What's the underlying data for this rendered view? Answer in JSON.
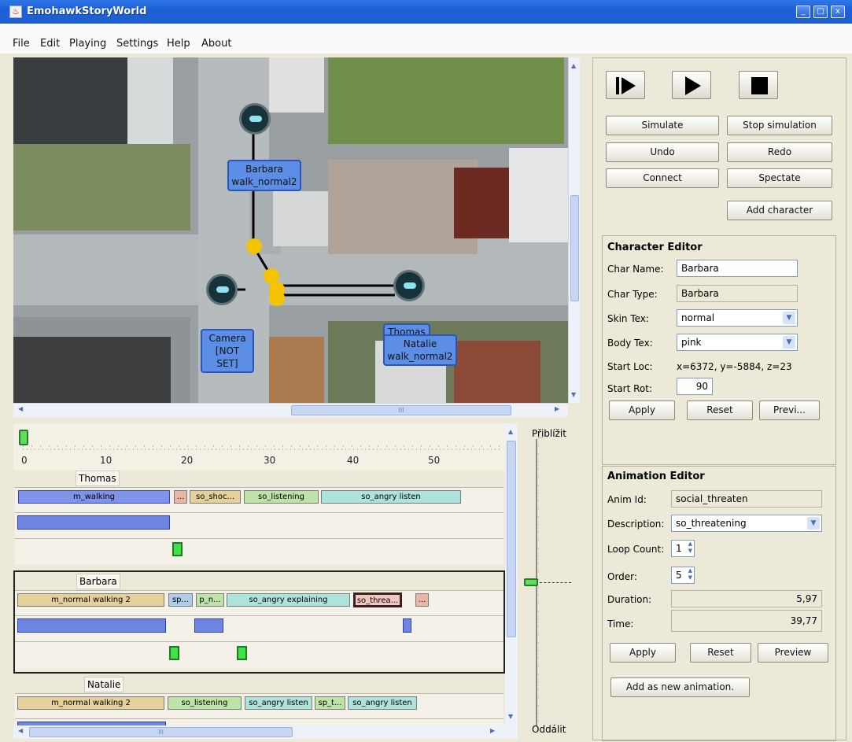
{
  "window": {
    "title": "EmohawkStoryWorld"
  },
  "menu": [
    "File",
    "Edit",
    "Playing",
    "Settings",
    "Help",
    "About"
  ],
  "map": {
    "labels": {
      "barbara": [
        "Barbara",
        "walk_normal2"
      ],
      "camera": [
        "Camera",
        "[NOT SET]"
      ],
      "thomas": "Thomas",
      "natalie": [
        "Natalie",
        "walk_normal2"
      ]
    },
    "hscroll_grip": "III"
  },
  "timeline": {
    "ticks": [
      "0",
      "10",
      "20",
      "30",
      "40",
      "50"
    ],
    "tracks": [
      {
        "name": "Thomas",
        "segments": [
          "m_walking",
          "...",
          "so_shoc...",
          "so_listening",
          "so_angry listen"
        ]
      },
      {
        "name": "Barbara",
        "segments": [
          "m_normal walking 2",
          "sp...",
          "p_n...",
          "so_angry explaining",
          "so_threa...",
          "..."
        ]
      },
      {
        "name": "Natalie",
        "segments": [
          "m_normal walking 2",
          "so_listening",
          "so_angry listen",
          "sp_t...",
          "so_angry listen"
        ]
      }
    ],
    "zoom_in_label": "Přiblížit",
    "zoom_out_label": "Oddálit",
    "hscroll_grip": "III"
  },
  "controls": {
    "simulate": "Simulate",
    "stop_simulation": "Stop simulation",
    "undo": "Undo",
    "redo": "Redo",
    "connect": "Connect",
    "spectate": "Spectate",
    "add_character": "Add character"
  },
  "character_editor": {
    "title": "Character Editor",
    "char_name_label": "Char Name:",
    "char_name": "Barbara",
    "char_type_label": "Char Type:",
    "char_type": "Barbara",
    "skin_tex_label": "Skin Tex:",
    "skin_tex": "normal",
    "body_tex_label": "Body Tex:",
    "body_tex": "pink",
    "start_loc_label": "Start Loc:",
    "start_loc": "x=6372, y=-5884, z=23",
    "start_rot_label": "Start Rot:",
    "start_rot": "90",
    "apply": "Apply",
    "reset": "Reset",
    "preview": "Previ..."
  },
  "animation_editor": {
    "title": "Animation Editor",
    "anim_id_label": "Anim Id:",
    "anim_id": "social_threaten",
    "description_label": "Description:",
    "description": "so_threatening",
    "loop_count_label": "Loop Count:",
    "loop_count": "1",
    "order_label": "Order:",
    "order": "5",
    "duration_label": "Duration:",
    "duration": "5,97",
    "time_label": "Time:",
    "time": "39,77",
    "apply": "Apply",
    "reset": "Reset",
    "preview": "Preview",
    "add_new": "Add as new animation."
  },
  "colors": {
    "titlebar": "#1d5fd6",
    "node_label": "#5c8ee6",
    "waypoint": "#f4c400",
    "segment_blue": "#6e86e0",
    "marker_green": "#3ee24a"
  }
}
